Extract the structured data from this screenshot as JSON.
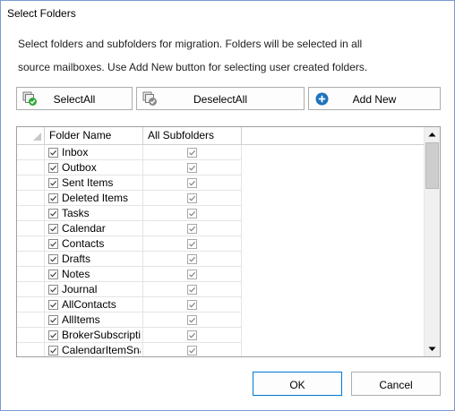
{
  "window": {
    "title": "Select Folders"
  },
  "description": {
    "line1": "Select folders and subfolders for migration. Folders will be selected in all",
    "line2": "source mailboxes. Use Add New button for selecting user created folders."
  },
  "toolbar": {
    "select_all": "SelectAll",
    "deselect_all": "DeselectAll",
    "add_new": "Add New"
  },
  "grid": {
    "columns": [
      "Folder Name",
      "All Subfolders"
    ],
    "rows": [
      {
        "name": "Inbox",
        "folder_checked": true,
        "subfolders_checked": true
      },
      {
        "name": "Outbox",
        "folder_checked": true,
        "subfolders_checked": true
      },
      {
        "name": "Sent Items",
        "folder_checked": true,
        "subfolders_checked": true
      },
      {
        "name": "Deleted Items",
        "folder_checked": true,
        "subfolders_checked": true
      },
      {
        "name": "Tasks",
        "folder_checked": true,
        "subfolders_checked": true
      },
      {
        "name": "Calendar",
        "folder_checked": true,
        "subfolders_checked": true
      },
      {
        "name": "Contacts",
        "folder_checked": true,
        "subfolders_checked": true
      },
      {
        "name": "Drafts",
        "folder_checked": true,
        "subfolders_checked": true
      },
      {
        "name": "Notes",
        "folder_checked": true,
        "subfolders_checked": true
      },
      {
        "name": "Journal",
        "folder_checked": true,
        "subfolders_checked": true
      },
      {
        "name": "AllContacts",
        "folder_checked": true,
        "subfolders_checked": true
      },
      {
        "name": "AllItems",
        "folder_checked": true,
        "subfolders_checked": true
      },
      {
        "name": "BrokerSubscripti...",
        "folder_checked": true,
        "subfolders_checked": true
      },
      {
        "name": "CalendarItemSna...",
        "folder_checked": true,
        "subfolders_checked": true
      }
    ]
  },
  "footer": {
    "ok": "OK",
    "cancel": "Cancel"
  },
  "colors": {
    "accent": "#0078d7",
    "add_icon": "#1e73be",
    "check_green": "#2eaa3a"
  },
  "icons": [
    "select-all-icon",
    "deselect-all-icon",
    "add-new-icon"
  ]
}
